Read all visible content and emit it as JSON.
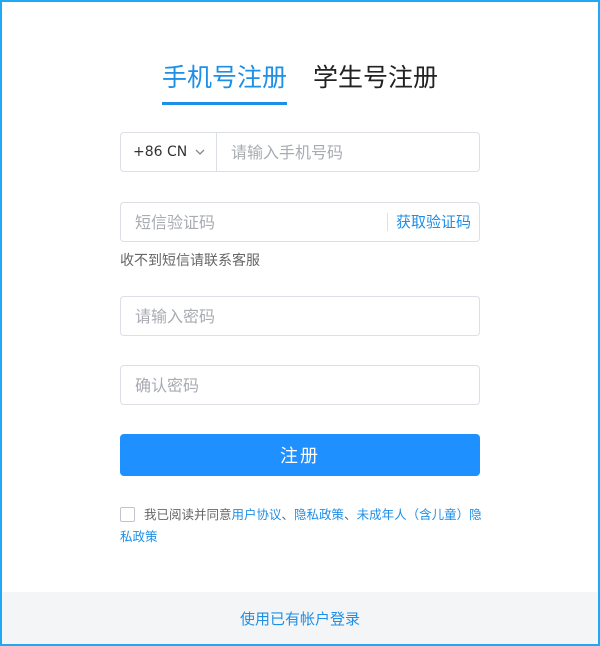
{
  "tabs": [
    {
      "label": "手机号注册",
      "active": true
    },
    {
      "label": "学生号注册",
      "active": false
    }
  ],
  "phone": {
    "country_code": "+86 CN",
    "placeholder": "请输入手机号码"
  },
  "sms": {
    "placeholder": "短信验证码",
    "get_code_label": "获取验证码",
    "hint": "收不到短信请联系客服"
  },
  "password": {
    "placeholder": "请输入密码"
  },
  "confirm_password": {
    "placeholder": "确认密码"
  },
  "submit_label": "注册",
  "agreement": {
    "prefix": "我已阅读并同意",
    "user_agreement": "用户协议",
    "sep1": "、",
    "privacy_policy": "隐私政策",
    "sep2": "、",
    "minor_policy": "未成年人（含儿童）隐私政策"
  },
  "footer": {
    "login_link": "使用已有帐户登录"
  },
  "colors": {
    "accent": "#1e8fe6",
    "border": "#20a8f5",
    "button": "#1e90ff"
  }
}
